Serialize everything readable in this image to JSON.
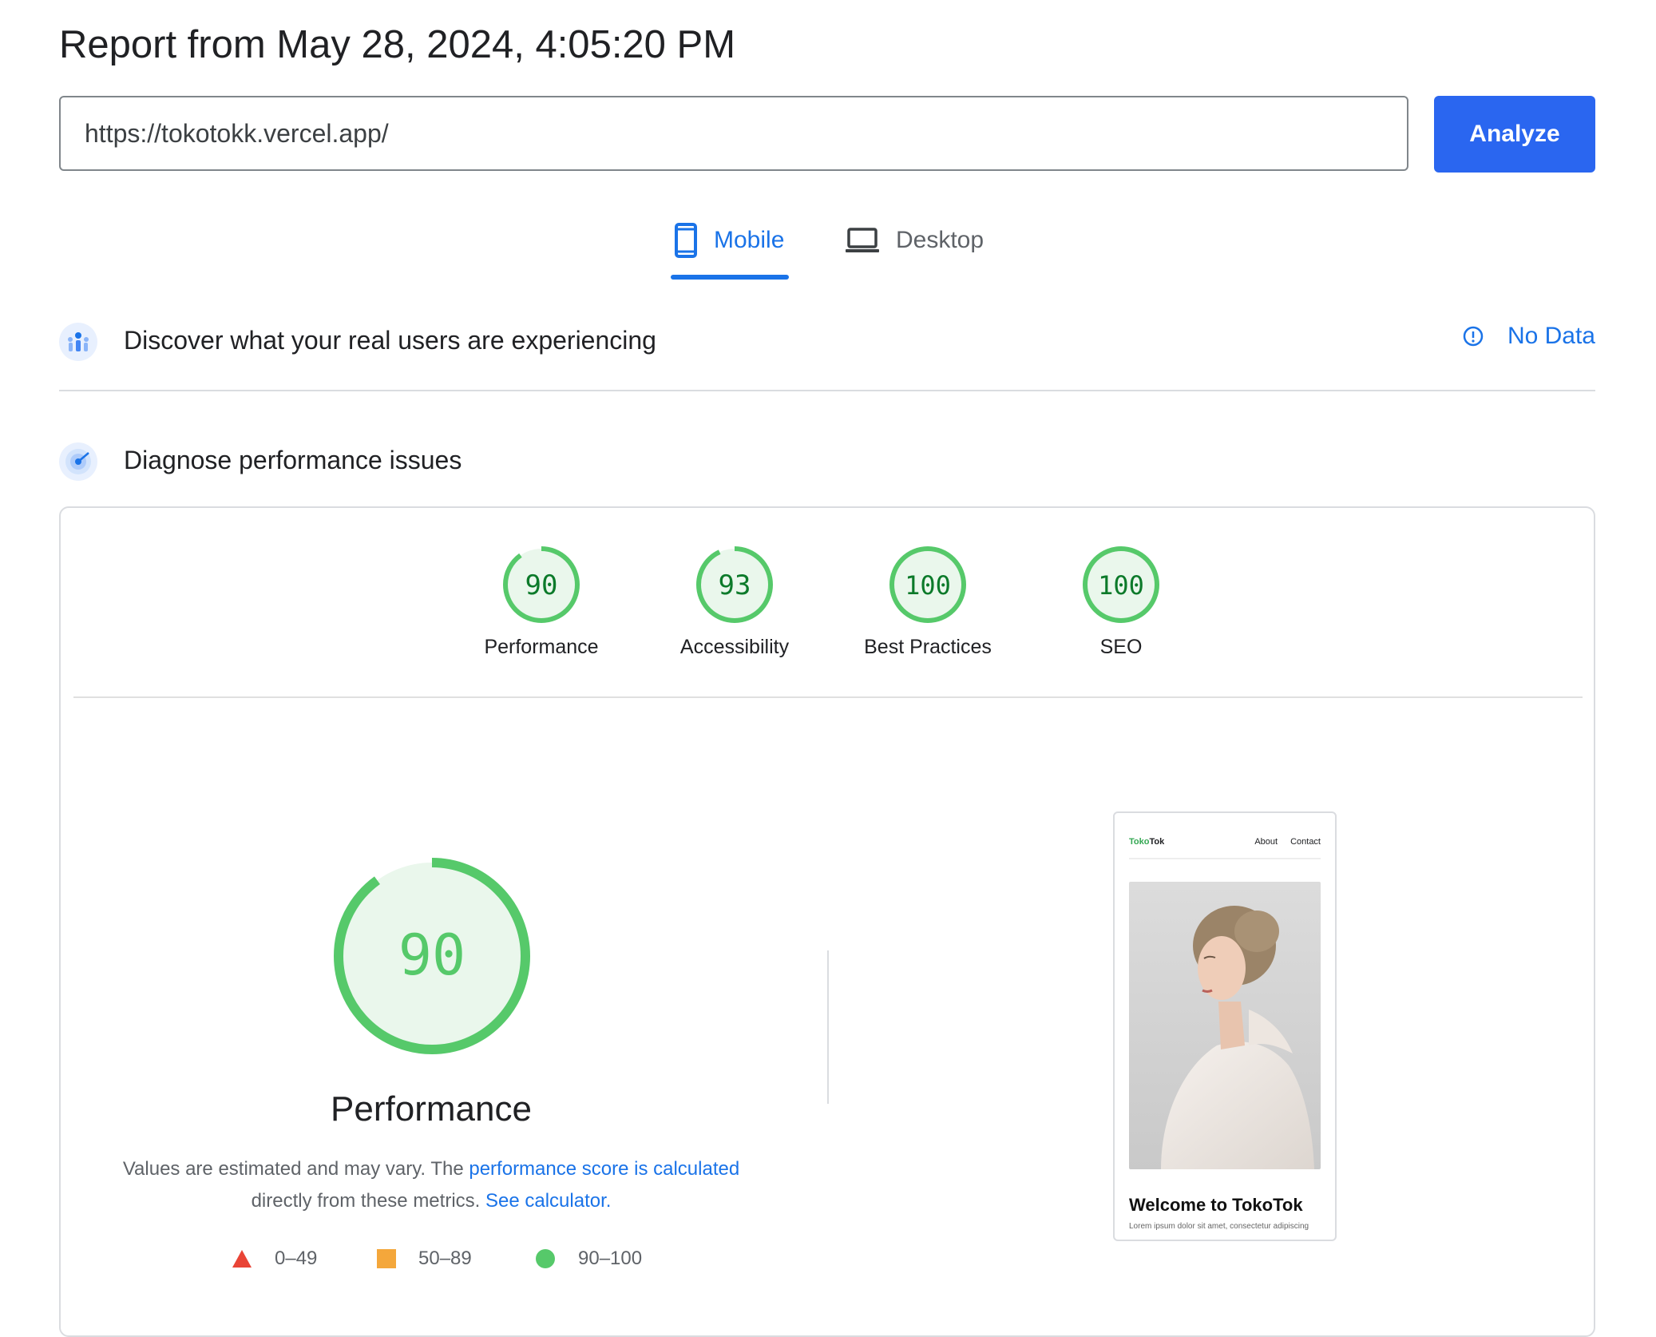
{
  "header": {
    "title": "Report from May 28, 2024, 4:05:20 PM",
    "url": "https://tokotokk.vercel.app/",
    "analyze_label": "Analyze"
  },
  "tabs": {
    "mobile": "Mobile",
    "desktop": "Desktop",
    "active": "mobile"
  },
  "field_data": {
    "title": "Discover what your real users are experiencing",
    "status": "No Data"
  },
  "lab_data": {
    "title": "Diagnose performance issues",
    "scores": [
      {
        "label": "Performance",
        "value": "90"
      },
      {
        "label": "Accessibility",
        "value": "93"
      },
      {
        "label": "Best Practices",
        "value": "100"
      },
      {
        "label": "SEO",
        "value": "100"
      }
    ],
    "main": {
      "score": "90",
      "title": "Performance",
      "desc_prefix": "Values are estimated and may vary. The ",
      "desc_link1": "performance score is calculated",
      "desc_mid": "directly from these metrics.",
      "desc_link2": "See calculator."
    },
    "legend": [
      {
        "range": "0–49",
        "shape": "triangle",
        "color": "#e94436"
      },
      {
        "range": "50–89",
        "shape": "square",
        "color": "#f4a73b"
      },
      {
        "range": "90–100",
        "shape": "circle",
        "color": "#56c96a"
      }
    ]
  },
  "preview": {
    "brand_a": "Toko",
    "brand_b": "Tok",
    "nav_about": "About",
    "nav_contact": "Contact",
    "heading": "Welcome to TokoTok",
    "body": "Lorem ipsum dolor sit amet, consectetur adipiscing"
  },
  "colors": {
    "accent": "#1a73e8",
    "button": "#2a66f0",
    "pass": "#56c96a",
    "pass_bg": "#eaf7ec",
    "pass_text": "#0c7a2a"
  }
}
